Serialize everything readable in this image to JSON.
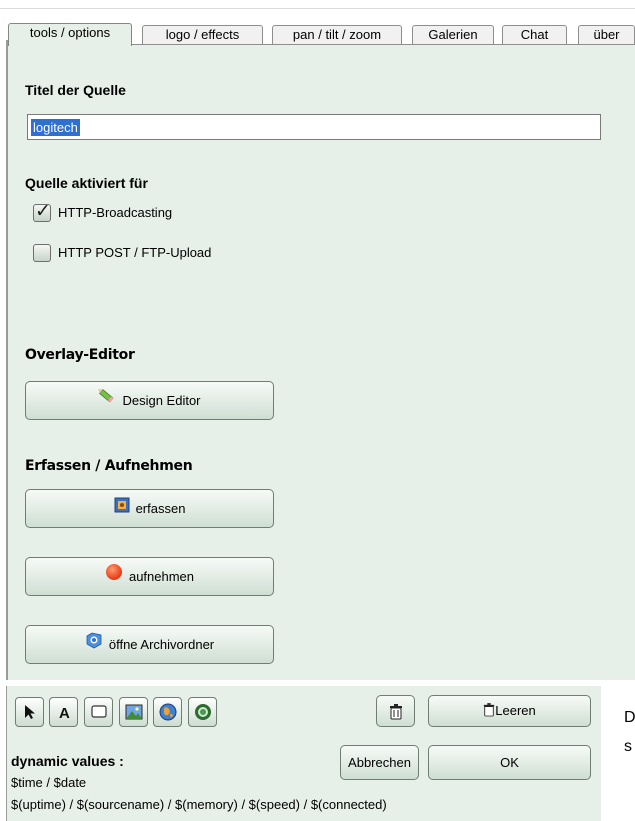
{
  "tabs": [
    {
      "label": "tools / options",
      "active": true
    },
    {
      "label": "logo / effects",
      "active": false
    },
    {
      "label": "pan / tilt / zoom",
      "active": false
    },
    {
      "label": "Galerien",
      "active": false
    },
    {
      "label": "Chat",
      "active": false
    },
    {
      "label": "über",
      "active": false
    }
  ],
  "source": {
    "title_label": "Titel der Quelle",
    "title_value": "logitech",
    "activated_label": "Quelle aktiviert für",
    "options": [
      {
        "label": "HTTP-Broadcasting",
        "checked": true
      },
      {
        "label": "HTTP POST / FTP-Upload",
        "checked": false
      }
    ]
  },
  "overlay": {
    "heading": "Overlay-Editor",
    "design_button": "Design Editor",
    "design_icon": "pencil-icon"
  },
  "capture": {
    "heading": "Erfassen / Aufnehmen",
    "capture_button": "erfassen",
    "capture_icon": "camera-icon",
    "record_button": "aufnehmen",
    "record_icon": "record-icon",
    "archive_button": "öffne Archivordner",
    "archive_icon": "folder-globe-icon"
  },
  "editor": {
    "tools": [
      "pointer-icon",
      "text-icon",
      "rectangle-icon",
      "image-icon",
      "globe-icon",
      "circle-icon"
    ],
    "trash_icon": "trash-icon",
    "clear_button": "Leeren",
    "cancel_button": "Abbrechen",
    "ok_button": "OK",
    "dynamic_title": "dynamic values :",
    "dynamic_line1": "$time / $date",
    "dynamic_line2": "$(uptime) / $(sourcename) / $(memory) / $(speed) / $(connected)"
  },
  "cut_text": {
    "line1": "D",
    "line2": "s"
  },
  "colors": {
    "panel_bg": "#e6efe8",
    "selection": "#2f6fd0",
    "record_red": "#e83a1a"
  }
}
